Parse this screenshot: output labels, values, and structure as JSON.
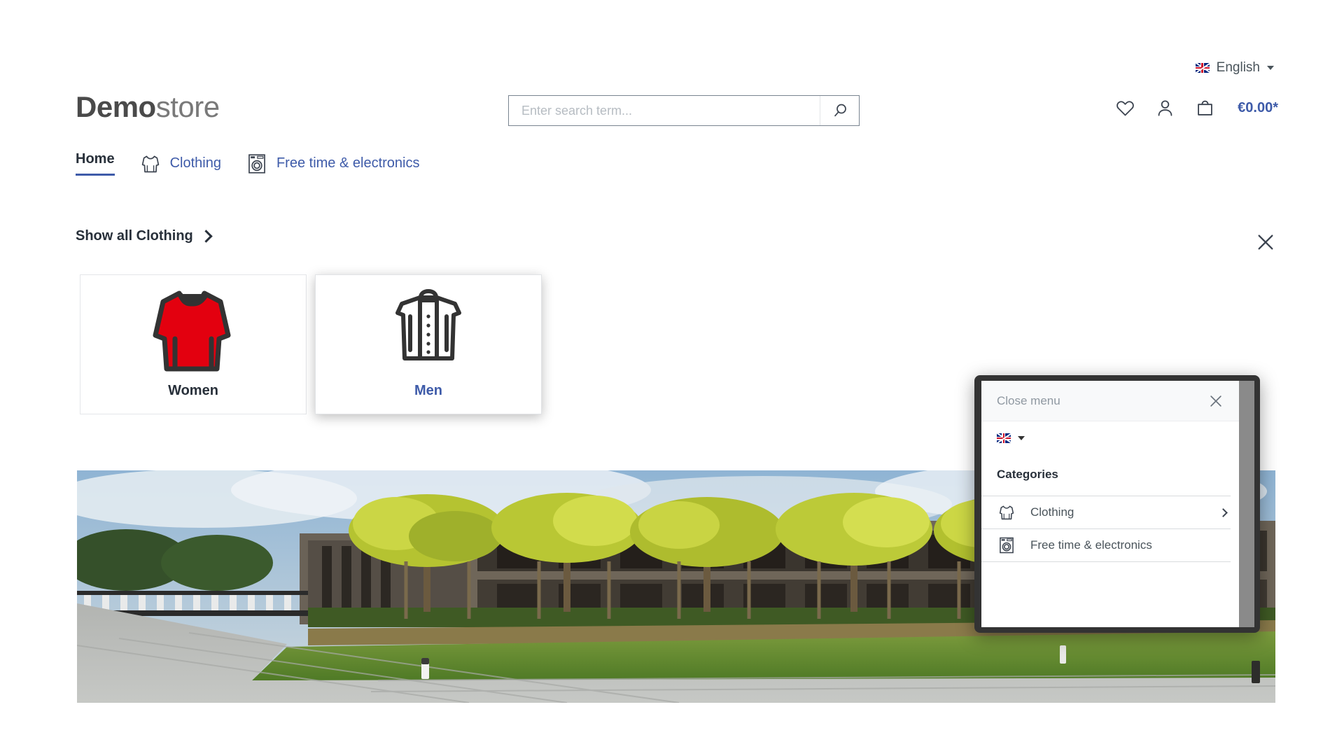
{
  "topbar": {
    "language_flag": "uk-flag-icon",
    "language_label": "English",
    "caret": "chevron-down-icon"
  },
  "header": {
    "logo_bold": "Demo",
    "logo_light": "store",
    "search": {
      "placeholder": "Enter search term...",
      "value": "",
      "button_icon": "search-icon"
    },
    "actions": {
      "wishlist_icon": "heart-icon",
      "account_icon": "user-icon",
      "cart_icon": "bag-icon",
      "cart_total": "€0.00*"
    }
  },
  "main_nav": {
    "items": [
      {
        "label": "Home",
        "icon": "",
        "active": true
      },
      {
        "label": "Clothing",
        "icon": "sweater-icon",
        "active": false
      },
      {
        "label": "Free time & electronics",
        "icon": "washing-machine-icon",
        "active": false
      }
    ]
  },
  "flyout": {
    "show_all_label": "Show all Clothing",
    "show_all_chevron": "chevron-right-icon",
    "close_icon": "close-icon",
    "cards": [
      {
        "label": "Women",
        "icon": "red-sweater-icon",
        "hover": false
      },
      {
        "label": "Men",
        "icon": "white-jacket-icon",
        "hover": true
      }
    ]
  },
  "hero": {
    "alt": "modern building courtyard with trees lawn and paved plaza"
  },
  "offcanvas": {
    "close_label": "Close menu",
    "close_icon": "close-icon",
    "language_flag": "uk-flag-icon",
    "language_caret": "chevron-down-icon",
    "categories_title": "Categories",
    "items": [
      {
        "label": "Clothing",
        "icon": "sweater-icon",
        "has_children": true
      },
      {
        "label": "Free time & electronics",
        "icon": "washing-machine-icon",
        "has_children": false
      }
    ]
  },
  "colors": {
    "brand_blue": "#3e5ba9",
    "text_dark": "#28303a",
    "text_muted": "#4a545b",
    "red": "#e3000f"
  }
}
